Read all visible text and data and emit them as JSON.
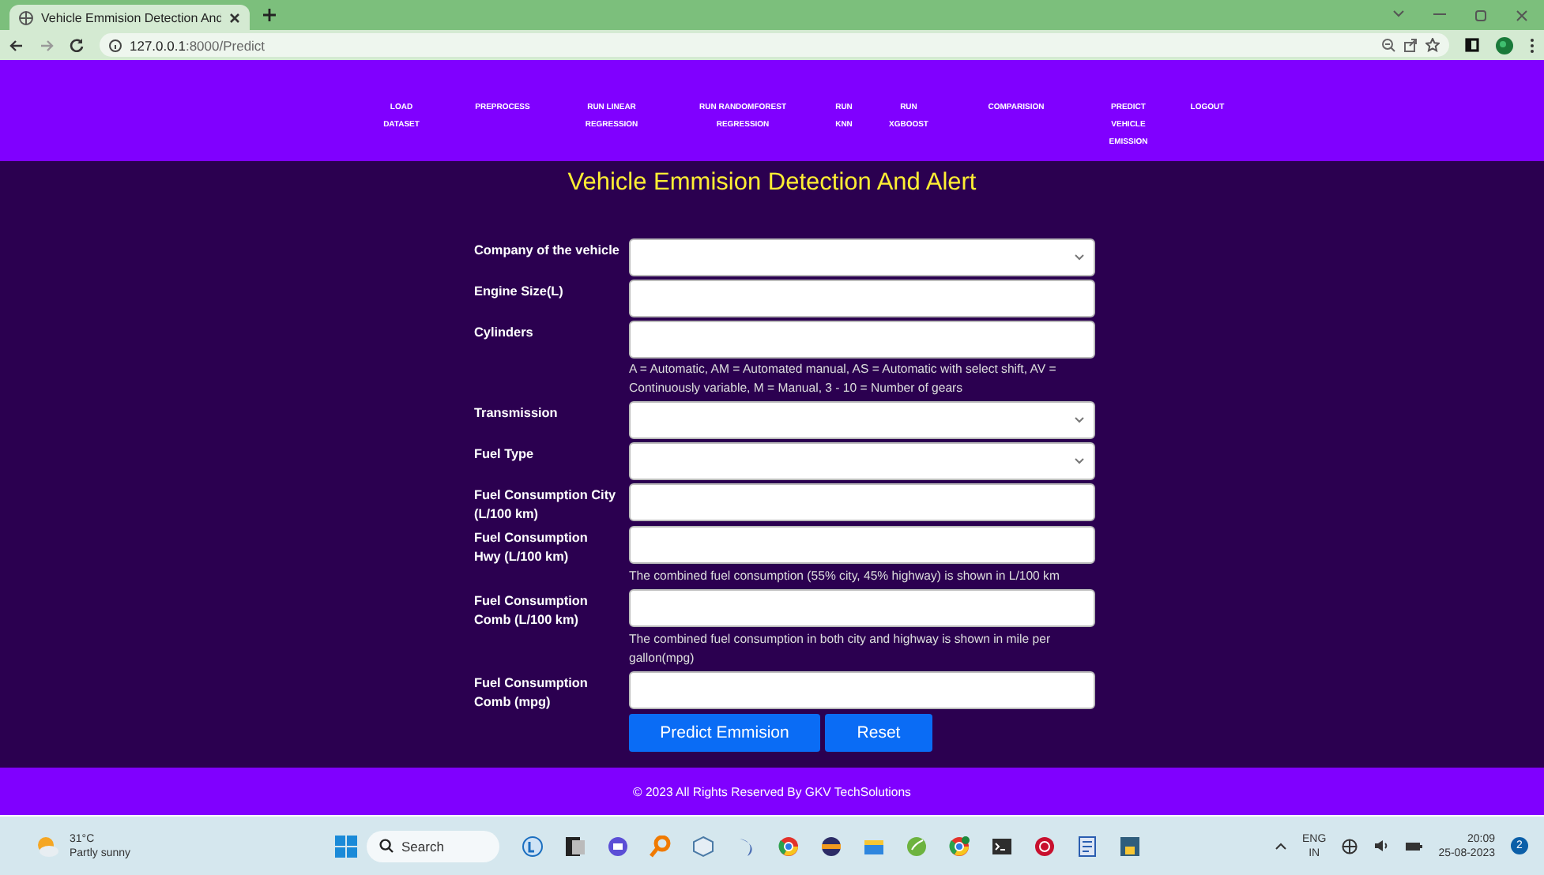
{
  "browser": {
    "tab_title": "Vehicle Emmision Detection And",
    "url_host": "127.0.0.1",
    "url_path": ":8000/Predict"
  },
  "nav": {
    "items": [
      {
        "label": "LOAD\nDATASET"
      },
      {
        "label": "PREPROCESS"
      },
      {
        "label": "RUN LINEAR\nREGRESSION"
      },
      {
        "label": "RUN RANDOMFOREST\nREGRESSION"
      },
      {
        "label": "RUN\nKNN"
      },
      {
        "label": "RUN\nXGBOOST"
      },
      {
        "label": "COMPARISION"
      },
      {
        "label": "PREDICT\nVEHICLE\nEMISSION"
      },
      {
        "label": "LOGOUT"
      }
    ]
  },
  "page_title": "Vehicle Emmision Detection And Alert",
  "form": {
    "fields": [
      {
        "label": "Company of the vehicle",
        "kind": "select"
      },
      {
        "label": "Engine Size(L)",
        "kind": "text"
      },
      {
        "label": "Cylinders",
        "kind": "text",
        "note": "A = Automatic, AM = Automated manual, AS = Automatic with select shift, AV = Continuously variable, M = Manual, 3 - 10 = Number of gears"
      },
      {
        "label": "Transmission",
        "kind": "select"
      },
      {
        "label": "Fuel Type",
        "kind": "select"
      },
      {
        "label": "Fuel Consumption City (L/100 km)",
        "kind": "text"
      },
      {
        "label": "Fuel Consumption Hwy (L/100 km)",
        "kind": "text",
        "note": "The combined fuel consumption (55% city, 45% highway) is shown in L/100 km"
      },
      {
        "label": "Fuel Consumption Comb (L/100 km)",
        "kind": "text",
        "note": "The combined fuel consumption in both city and highway is shown in mile per gallon(mpg)"
      },
      {
        "label": "Fuel Consumption Comb (mpg)",
        "kind": "text"
      }
    ],
    "buttons": [
      {
        "label": "Predict Emmision"
      },
      {
        "label": "Reset"
      }
    ]
  },
  "footer": "© 2023 All Rights Reserved By GKV TechSolutions",
  "taskbar": {
    "temperature": "31°C",
    "weather": "Partly sunny",
    "search_placeholder": "Search",
    "language": "ENG",
    "region": "IN",
    "time": "20:09",
    "date": "25-08-2023",
    "notifications": "2"
  }
}
